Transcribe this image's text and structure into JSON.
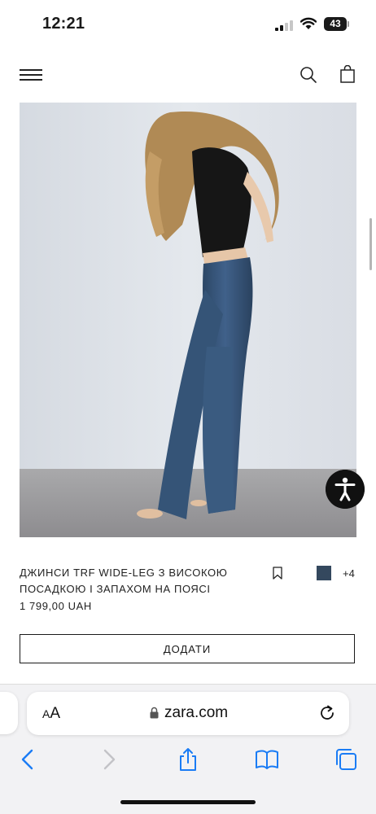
{
  "status_bar": {
    "time": "12:21",
    "battery": "43"
  },
  "header": {
    "menu_icon": "hamburger-menu-icon",
    "search_icon": "search-icon",
    "bag_icon": "shopping-bag-icon"
  },
  "product": {
    "title": "ДЖИНСИ TRF WIDE-LEG З ВИСОКОЮ ПОСАДКОЮ І ЗАПАХОМ НА ПОЯСІ",
    "price": "1 799,00 UAH",
    "swatch_color": "#34485e",
    "more_colors": "+4",
    "add_button": "ДОДАТИ"
  },
  "browser": {
    "aa_big": "A",
    "aa_small": "A",
    "url": "zara.com"
  },
  "colors": {
    "accent": "#1a1a1a",
    "ios_blue": "#1a7cf5"
  }
}
